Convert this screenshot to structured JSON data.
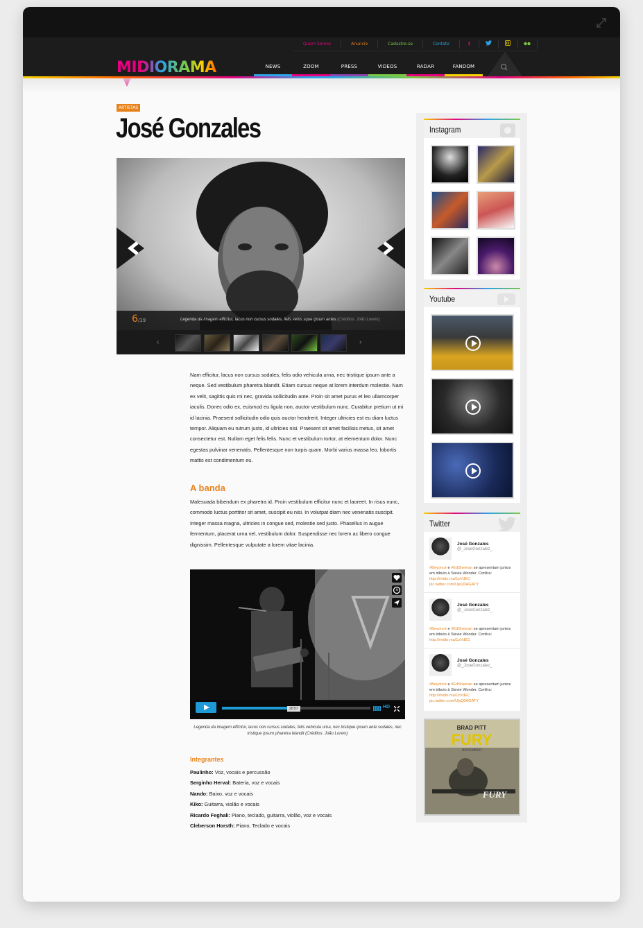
{
  "utility_nav": [
    {
      "label": "Quem Somos",
      "color": "#e6007e"
    },
    {
      "label": "Anuncie",
      "color": "#e8831b"
    },
    {
      "label": "Cadastre-se",
      "color": "#7ac943"
    },
    {
      "label": "Contato",
      "color": "#2ea3e6"
    }
  ],
  "social": [
    {
      "icon": "facebook-icon",
      "glyph": "f",
      "color": "#e6007e"
    },
    {
      "icon": "twitter-icon",
      "glyph": "t",
      "color": "#2ea3e6"
    },
    {
      "icon": "instagram-icon",
      "glyph": "◙",
      "color": "#f6d400"
    },
    {
      "icon": "flickr-icon",
      "glyph": "●●",
      "color": "#7ac943"
    }
  ],
  "logo": {
    "text": "MIDIORAMA"
  },
  "main_nav": [
    "NEWS",
    "ZOOM",
    "PRESS",
    "VIDEOS",
    "RADAR",
    "FANDOM"
  ],
  "article": {
    "tag": "ARTISTAS",
    "title": "José Gonzales",
    "slider": {
      "current": "6",
      "total": "/19",
      "caption": "Legenda da imagem efficitur, lacus non cursus sodales, felis vehis  sque ipsum antes ",
      "credit": "(Créditos: João Lorem)"
    },
    "body": "Nam efficitur, lacus non cursus sodales, felis odio vehicula urna, nec tristique ipsum ante a neque. Sed vestibulum pharetra blandit. Etiam cursus neque at lorem interdum molestie. Nam ex velit, sagittis quis mi nec, gravida sollicitudin ante. Proin sit amet purus et leo ullamcorper iaculis. Donec odio ex, euismod eu ligula non, auctor vestibulum nunc. Curabitur pretium ut mi id lacinia. Praesent sollicitudin odio quis auctor hendrerit. Integer ultricies est eu diam luctus tempor. Aliquam eu rutrum justo, id ultricies nisi. Praesent sit amet facilisis metus, sit amet consectetur est. Nullam eget felis felis. Nunc et vestibulum tortor, at elementum dolor. Nunc egestas pulvinar venenatis. Pellentesque non turpis quam. Morbi varius massa leo, lobortis mattis est condimentum eu.",
    "banda_heading": "A banda",
    "banda_text": "Malesuada bibendum ex pharetra id. Proin vestibulum efficitur nunc et laoreet. In risus nunc, commodo luctus porttitor sit amet, suscipit eu nisi. In volutpat diam nec venenatis suscipit. Integer massa magna, ultricies in congue sed, molestie sed justo. Phasellus in augue fermentum, placerat urna vel, vestibulum dolor. Suspendisse nec lorem ac libero congue dignissim. Pellentesque vulputate a lorem vitae lacinia.",
    "video": {
      "time": "20:57",
      "hd": "HD",
      "progress": 0.53,
      "caption": "Legenda da imagem efficitur, lacus non cursus sodales, felis vehicula urna, nec tristique ipsum ante sodales, nec tristique ipsum pharetra blandit (Créditos: João Lorem)"
    },
    "integrantes_heading": "Integrantes",
    "integrantes": [
      {
        "name": "Paulinho:",
        "role": " Voz, vocais e percussão"
      },
      {
        "name": "Serginho Herval:",
        "role": " Bateria, voz e vocais"
      },
      {
        "name": "Nando:",
        "role": " Baixo, voz e vocais"
      },
      {
        "name": "Kiko:",
        "role": " Guitarra, violão e vocais"
      },
      {
        "name": "Ricardo Feghali:",
        "role": " Piano, teclado, guitarra, violão, voz e vocais"
      },
      {
        "name": "Cleberson Horsth:",
        "role": " Piano, Teclado e vocais"
      }
    ]
  },
  "sidebar": {
    "instagram_title": "Instagram",
    "youtube_title": "Youtube",
    "twitter_title": "Twitter",
    "tweets": [
      {
        "name": "José Gonzales",
        "handle": "@_JoseGonzalez_",
        "t1": "#Beyoncé",
        "mid": " e ",
        "t2": "#EdSheeran",
        "rest": " se apresentam juntos em tributo à Stevie Wonder. Confira: ",
        "link": "http://midio.ma/1zVdEC",
        "pic": "pic.twitter.com/UjsQ0AGATY"
      },
      {
        "name": "José Gonzales",
        "handle": "@_JoseGonzalez_",
        "t1": "#Beyoncé",
        "mid": " e ",
        "t2": "#EdSheeran",
        "rest": " se apresentam juntos em tributo à Stevie Wonder. Confira: ",
        "link": "http://midio.ma/1zVdEC",
        "pic": ""
      },
      {
        "name": "José Gonzales",
        "handle": "@_JoseGonzalez_",
        "t1": "#Beyoncé",
        "mid": " e ",
        "t2": "#EdSheeran",
        "rest": " se apresentam juntos em tributo à Stevie Wonder. Confira: ",
        "link": "http://midio.ma/1zVdEC",
        "pic": "pic.twitter.com/UjsQ0AGATY"
      }
    ],
    "ad": {
      "top": "BRAD PITT",
      "title": "FURY",
      "sub": "NOVEMBER",
      "bottom": "FURY"
    }
  }
}
